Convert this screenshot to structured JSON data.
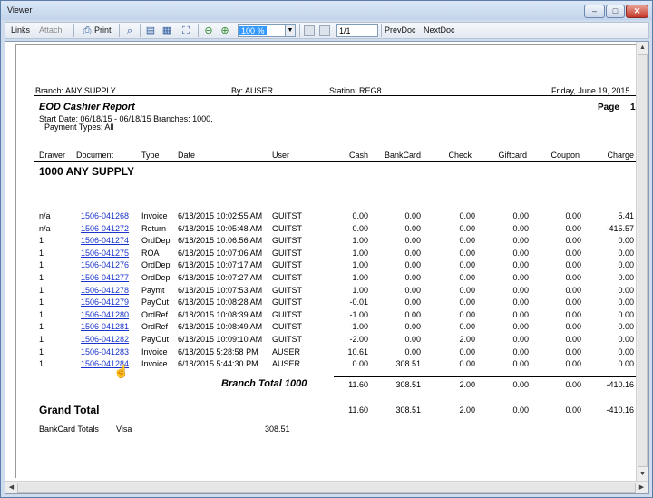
{
  "window": {
    "title": "Viewer",
    "buttons": {
      "minimize": "–",
      "maximize": "□",
      "close": "✕"
    }
  },
  "toolbar": {
    "links": "Links",
    "attach": "Attach",
    "print": "Print",
    "zoom": "100 %",
    "page": "1/1",
    "prev_doc": "PrevDoc",
    "next_doc": "NextDoc"
  },
  "report": {
    "branch_line": "Branch: ANY SUPPLY",
    "by_line": "By: AUSER",
    "station_line": "Station: REG8",
    "date_line": "Friday, June 19, 2015",
    "title": "EOD Cashier Report",
    "page_label": "Page",
    "page_number": "1",
    "criteria_line1": "Start Date: 06/18/15  - 06/18/15  Branches: 1000,",
    "criteria_line2": "Payment Types: All",
    "columns": [
      "Drawer",
      "Document",
      "Type",
      "Date",
      "User",
      "Cash",
      "BankCard",
      "Check",
      "Giftcard",
      "Coupon",
      "Charge"
    ],
    "branch_heading": "1000 ANY SUPPLY",
    "rows": [
      {
        "drawer": "n/a",
        "document": "1506-041268",
        "type": "Invoice",
        "date": "6/18/2015 10:02:55 AM",
        "user": "GUITST",
        "cash": "0.00",
        "bankcard": "0.00",
        "check": "0.00",
        "giftcard": "0.00",
        "coupon": "0.00",
        "charge": "5.41"
      },
      {
        "drawer": "n/a",
        "document": "1506-041272",
        "type": "Return",
        "date": "6/18/2015 10:05:48 AM",
        "user": "GUITST",
        "cash": "0.00",
        "bankcard": "0.00",
        "check": "0.00",
        "giftcard": "0.00",
        "coupon": "0.00",
        "charge": "-415.57"
      },
      {
        "drawer": "1",
        "document": "1506-041274",
        "type": "OrdDep",
        "date": "6/18/2015 10:06:56 AM",
        "user": "GUITST",
        "cash": "1.00",
        "bankcard": "0.00",
        "check": "0.00",
        "giftcard": "0.00",
        "coupon": "0.00",
        "charge": "0.00"
      },
      {
        "drawer": "1",
        "document": "1506-041275",
        "type": "ROA",
        "date": "6/18/2015 10:07:06 AM",
        "user": "GUITST",
        "cash": "1.00",
        "bankcard": "0.00",
        "check": "0.00",
        "giftcard": "0.00",
        "coupon": "0.00",
        "charge": "0.00"
      },
      {
        "drawer": "1",
        "document": "1506-041276",
        "type": "OrdDep",
        "date": "6/18/2015 10:07:17 AM",
        "user": "GUITST",
        "cash": "1.00",
        "bankcard": "0.00",
        "check": "0.00",
        "giftcard": "0.00",
        "coupon": "0.00",
        "charge": "0.00"
      },
      {
        "drawer": "1",
        "document": "1506-041277",
        "type": "OrdDep",
        "date": "6/18/2015 10:07:27 AM",
        "user": "GUITST",
        "cash": "1.00",
        "bankcard": "0.00",
        "check": "0.00",
        "giftcard": "0.00",
        "coupon": "0.00",
        "charge": "0.00"
      },
      {
        "drawer": "1",
        "document": "1506-041278",
        "type": "Paymt",
        "date": "6/18/2015 10:07:53 AM",
        "user": "GUITST",
        "cash": "1.00",
        "bankcard": "0.00",
        "check": "0.00",
        "giftcard": "0.00",
        "coupon": "0.00",
        "charge": "0.00"
      },
      {
        "drawer": "1",
        "document": "1506-041279",
        "type": "PayOut",
        "date": "6/18/2015 10:08:28 AM",
        "user": "GUITST",
        "cash": "-0.01",
        "bankcard": "0.00",
        "check": "0.00",
        "giftcard": "0.00",
        "coupon": "0.00",
        "charge": "0.00"
      },
      {
        "drawer": "1",
        "document": "1506-041280",
        "type": "OrdRef",
        "date": "6/18/2015 10:08:39 AM",
        "user": "GUITST",
        "cash": "-1.00",
        "bankcard": "0.00",
        "check": "0.00",
        "giftcard": "0.00",
        "coupon": "0.00",
        "charge": "0.00"
      },
      {
        "drawer": "1",
        "document": "1506-041281",
        "type": "OrdRef",
        "date": "6/18/2015 10:08:49 AM",
        "user": "GUITST",
        "cash": "-1.00",
        "bankcard": "0.00",
        "check": "0.00",
        "giftcard": "0.00",
        "coupon": "0.00",
        "charge": "0.00"
      },
      {
        "drawer": "1",
        "document": "1506-041282",
        "type": "PayOut",
        "date": "6/18/2015 10:09:10 AM",
        "user": "GUITST",
        "cash": "-2.00",
        "bankcard": "0.00",
        "check": "2.00",
        "giftcard": "0.00",
        "coupon": "0.00",
        "charge": "0.00"
      },
      {
        "drawer": "1",
        "document": "1506-041283",
        "type": "Invoice",
        "date": "6/18/2015 5:28:58 PM",
        "user": "AUSER",
        "cash": "10.61",
        "bankcard": "0.00",
        "check": "0.00",
        "giftcard": "0.00",
        "coupon": "0.00",
        "charge": "0.00"
      },
      {
        "drawer": "1",
        "document": "1506-041284",
        "type": "Invoice",
        "date": "6/18/2015 5:44:30 PM",
        "user": "AUSER",
        "cash": "0.00",
        "bankcard": "308.51",
        "check": "0.00",
        "giftcard": "0.00",
        "coupon": "0.00",
        "charge": "0.00"
      }
    ],
    "branch_total": {
      "label": "Branch Total 1000",
      "cash": "11.60",
      "bankcard": "308.51",
      "check": "2.00",
      "giftcard": "0.00",
      "coupon": "0.00",
      "charge": "-410.16"
    },
    "grand_total": {
      "label": "Grand Total",
      "cash": "11.60",
      "bankcard": "308.51",
      "check": "2.00",
      "giftcard": "0.00",
      "coupon": "0.00",
      "charge": "-410.16"
    },
    "bankcard_totals": {
      "label": "BankCard Totals",
      "type": "Visa",
      "amount": "308.51"
    }
  }
}
